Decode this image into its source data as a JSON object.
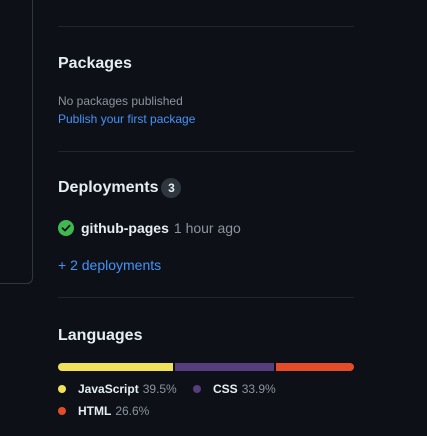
{
  "packages": {
    "heading": "Packages",
    "empty_text": "No packages published",
    "publish_link": "Publish your first package"
  },
  "deployments": {
    "heading": "Deployments",
    "count": "3",
    "latest": {
      "environment": "github-pages",
      "time": "1 hour ago",
      "status_icon": "check-circle-icon",
      "status_color": "#3fb950"
    },
    "more_link": "+ 2 deployments"
  },
  "languages": {
    "heading": "Languages",
    "items": [
      {
        "name": "JavaScript",
        "percent": "39.5%",
        "value": 39.5,
        "color": "#f1e05a"
      },
      {
        "name": "CSS",
        "percent": "33.9%",
        "value": 33.9,
        "color": "#563d7c"
      },
      {
        "name": "HTML",
        "percent": "26.6%",
        "value": 26.6,
        "color": "#e34c26"
      }
    ]
  },
  "colors": {
    "background": "#0d1117",
    "link": "#4493f8",
    "muted": "#8b949e",
    "divider": "#21262d"
  }
}
